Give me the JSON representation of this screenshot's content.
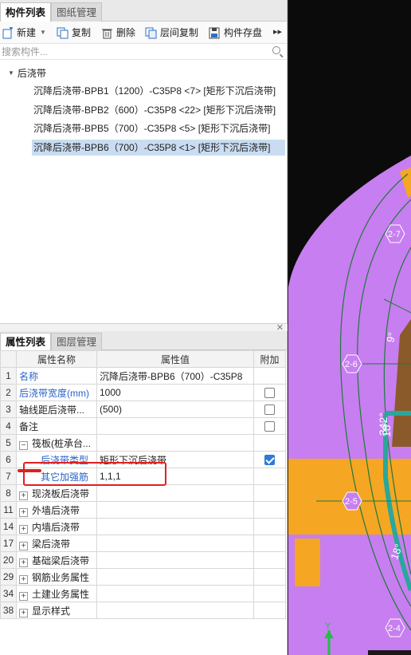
{
  "top_panel": {
    "tabs": [
      {
        "label": "构件列表",
        "active": true
      },
      {
        "label": "图纸管理",
        "active": false
      }
    ],
    "toolbar": {
      "new": "新建",
      "copy": "复制",
      "delete": "删除",
      "floor_copy": "层间复制",
      "save": "构件存盘"
    },
    "search_placeholder": "搜索构件...",
    "tree": {
      "root": "后浇带",
      "items": [
        "沉降后浇带-BPB1（1200）-C35P8 <7> [矩形下沉后浇带]",
        "沉降后浇带-BPB2（600）-C35P8 <22> [矩形下沉后浇带]",
        "沉降后浇带-BPB5（700）-C35P8 <5> [矩形下沉后浇带]",
        "沉降后浇带-BPB6（700）-C35P8 <1> [矩形下沉后浇带]"
      ],
      "selected_index": 3
    }
  },
  "prop_panel": {
    "tabs": [
      {
        "label": "属性列表",
        "active": true
      },
      {
        "label": "图层管理",
        "active": false
      }
    ],
    "headers": {
      "name": "属性名称",
      "value": "属性值",
      "extra": "附加"
    },
    "rows": [
      {
        "num": "1",
        "name": "名称",
        "value": "沉降后浇带-BPB6（700）-C35P8",
        "blue": true,
        "checkbox": "none"
      },
      {
        "num": "2",
        "name": "后浇带宽度(mm)",
        "value": "1000",
        "blue": true,
        "checkbox": "empty"
      },
      {
        "num": "3",
        "name": "轴线距后浇带...",
        "value": "(500)",
        "blue": false,
        "checkbox": "empty"
      },
      {
        "num": "4",
        "name": "备注",
        "value": "",
        "blue": false,
        "checkbox": "empty"
      },
      {
        "num": "5",
        "name": "筏板(桩承台...",
        "value": "",
        "blue": false,
        "expand": "−",
        "checkbox": "none"
      },
      {
        "num": "6",
        "name": "后浇带类型",
        "value": "矩形下沉后浇带",
        "blue": true,
        "indent": true,
        "checkbox": "checked"
      },
      {
        "num": "7",
        "name": "其它加强筋",
        "value": "1,1,1",
        "blue": true,
        "indent": true,
        "checkbox": "none"
      },
      {
        "num": "8",
        "name": "现浇板后浇带",
        "value": "",
        "blue": false,
        "expand": "+",
        "checkbox": "none"
      },
      {
        "num": "11",
        "name": "外墙后浇带",
        "value": "",
        "blue": false,
        "expand": "+",
        "checkbox": "none"
      },
      {
        "num": "14",
        "name": "内墙后浇带",
        "value": "",
        "blue": false,
        "expand": "+",
        "checkbox": "none"
      },
      {
        "num": "17",
        "name": "梁后浇带",
        "value": "",
        "blue": false,
        "expand": "+",
        "checkbox": "none"
      },
      {
        "num": "20",
        "name": "基础梁后浇带",
        "value": "",
        "blue": false,
        "expand": "+",
        "checkbox": "none"
      },
      {
        "num": "29",
        "name": "钢筋业务属性",
        "value": "",
        "blue": false,
        "expand": "+",
        "checkbox": "none"
      },
      {
        "num": "34",
        "name": "土建业务属性",
        "value": "",
        "blue": false,
        "expand": "+",
        "checkbox": "none"
      },
      {
        "num": "38",
        "name": "显示样式",
        "value": "",
        "blue": false,
        "expand": "+",
        "checkbox": "none"
      }
    ]
  },
  "canvas": {
    "labels": {
      "axis_2_7": "2-7",
      "axis_2_6": "2-6",
      "axis_2_5": "2-5",
      "axis_2_4": "2-4",
      "deg_9": "9°",
      "deg_342": "342°",
      "deg_18a": "18°",
      "deg_18b": "18°",
      "y_axis": "Y"
    },
    "colors": {
      "slab": "#c77ef0",
      "band": "#f5a623",
      "teal": "#2aa79b",
      "background": "#0b0b0b"
    }
  }
}
